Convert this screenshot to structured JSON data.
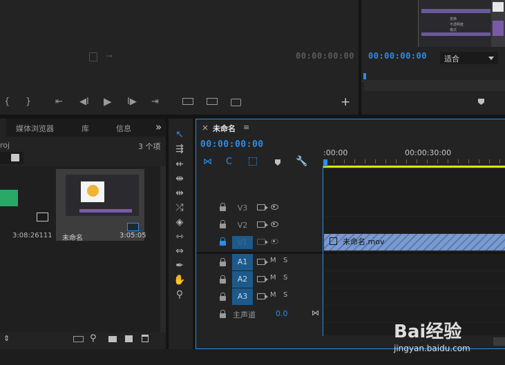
{
  "source_monitor": {
    "timecode": "00:00:00:00"
  },
  "program_monitor": {
    "timecode": "00:00:00:00",
    "fit_label": "适合",
    "thumb_rows": [
      "变换",
      "不透明度",
      "模式"
    ]
  },
  "project_panel": {
    "tabs": [
      "媒体浏览器",
      "库",
      "信息"
    ],
    "more": "»",
    "filename_fragment": "roj",
    "item_count": "3 个项",
    "items": [
      {
        "name": "",
        "duration": "3:08:26111"
      },
      {
        "name": "未命名",
        "duration": "3:05:05"
      }
    ]
  },
  "timeline": {
    "close": "×",
    "sequence_name": "未命名",
    "menu": "≡",
    "timecode": "00:00:00:00",
    "ruler": [
      ":00:00",
      "00:00:30:00"
    ],
    "video_tracks": [
      {
        "label": "V3"
      },
      {
        "label": "V2"
      },
      {
        "label": "V1"
      }
    ],
    "audio_tracks": [
      {
        "label": "A1",
        "m": "M",
        "s": "S"
      },
      {
        "label": "A2",
        "m": "M",
        "s": "S"
      },
      {
        "label": "A3",
        "m": "M",
        "s": "S"
      }
    ],
    "master": {
      "label": "主声道",
      "value": "0.0"
    },
    "clip_name": "未命名.mov"
  },
  "watermark": {
    "text": "Bai经验",
    "url": "jingyan.baidu.com"
  },
  "colors": {
    "accent_blue": "#2d8ceb",
    "track_selected": "#1d5a8c",
    "clip_fill": "#7a9ad0",
    "playhead": "#2d8ceb",
    "work_area": "#e6e600"
  }
}
